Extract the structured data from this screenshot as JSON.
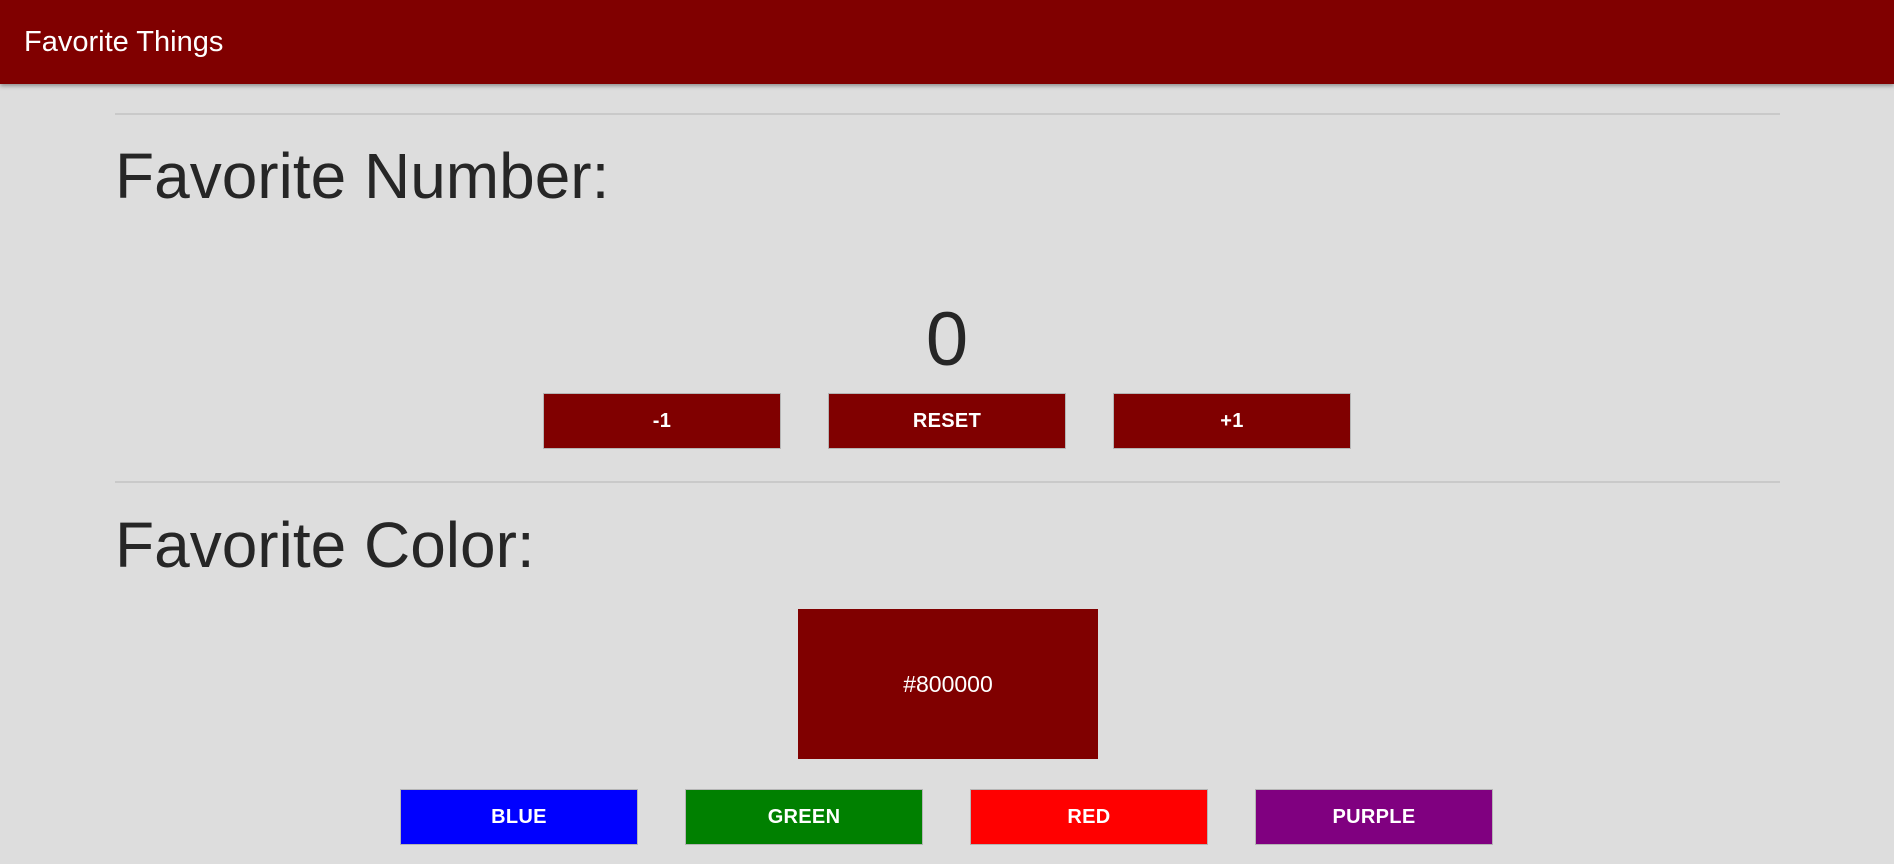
{
  "appbar": {
    "title": "Favorite Things",
    "background": "#800000"
  },
  "number_section": {
    "heading": "Favorite Number:",
    "value": "0",
    "buttons": {
      "decrement_label": "-1",
      "reset_label": "RESET",
      "increment_label": "+1"
    },
    "button_color": "#800000"
  },
  "color_section": {
    "heading": "Favorite Color:",
    "current_color": "#800000",
    "current_color_label": "#800000",
    "buttons": [
      {
        "label": "BLUE",
        "color": "#0000ff"
      },
      {
        "label": "GREEN",
        "color": "#008000"
      },
      {
        "label": "RED",
        "color": "#ff0000"
      },
      {
        "label": "PURPLE",
        "color": "#800080"
      }
    ]
  }
}
